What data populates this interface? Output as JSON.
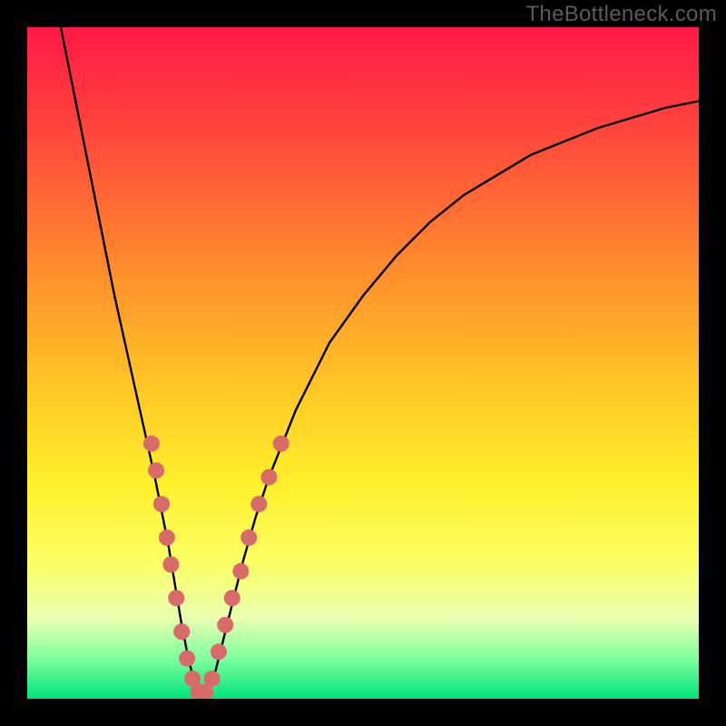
{
  "watermark": "TheBottleneck.com",
  "chart_data": {
    "type": "line",
    "title": "",
    "xlabel": "",
    "ylabel": "",
    "xlim": [
      0,
      100
    ],
    "ylim": [
      0,
      100
    ],
    "grid": false,
    "legend": false,
    "background_gradient": {
      "direction": "vertical",
      "stops": [
        {
          "pos": 0,
          "color": "#ff1a47"
        },
        {
          "pos": 12,
          "color": "#ff3b3f"
        },
        {
          "pos": 26,
          "color": "#ff6a33"
        },
        {
          "pos": 40,
          "color": "#ff9a2b"
        },
        {
          "pos": 54,
          "color": "#ffc826"
        },
        {
          "pos": 68,
          "color": "#fff02c"
        },
        {
          "pos": 80,
          "color": "#fbff66"
        },
        {
          "pos": 88,
          "color": "#e9ffb0"
        },
        {
          "pos": 94,
          "color": "#7fff9e"
        },
        {
          "pos": 100,
          "color": "#00e47a"
        }
      ]
    },
    "series": [
      {
        "name": "bottleneck-curve",
        "color": "#000000",
        "x": [
          5,
          7,
          9,
          11,
          13,
          15,
          17,
          19,
          21,
          22,
          23,
          24,
          25,
          26,
          27,
          28,
          30,
          32,
          34,
          36,
          40,
          45,
          50,
          55,
          60,
          65,
          70,
          75,
          80,
          85,
          90,
          95,
          100
        ],
        "y": [
          100,
          90,
          80,
          70,
          60,
          51,
          42,
          33,
          23,
          17,
          11,
          6,
          2,
          0,
          1,
          4,
          12,
          20,
          27,
          33,
          43,
          53,
          60,
          66,
          71,
          75,
          78,
          81,
          83,
          85,
          86.5,
          88,
          89
        ]
      }
    ],
    "markers": [
      {
        "name": "curve-markers",
        "shape": "circle",
        "color": "#d96a6a",
        "radius_px": 9,
        "points": [
          {
            "x": 18.5,
            "y": 38
          },
          {
            "x": 19.2,
            "y": 34
          },
          {
            "x": 20.0,
            "y": 29
          },
          {
            "x": 20.8,
            "y": 24
          },
          {
            "x": 21.4,
            "y": 20
          },
          {
            "x": 22.2,
            "y": 15
          },
          {
            "x": 23.0,
            "y": 10
          },
          {
            "x": 23.8,
            "y": 6
          },
          {
            "x": 24.6,
            "y": 3
          },
          {
            "x": 25.5,
            "y": 1
          },
          {
            "x": 26.5,
            "y": 1
          },
          {
            "x": 27.5,
            "y": 3
          },
          {
            "x": 28.5,
            "y": 7
          },
          {
            "x": 29.5,
            "y": 11
          },
          {
            "x": 30.5,
            "y": 15
          },
          {
            "x": 31.8,
            "y": 19
          },
          {
            "x": 33.0,
            "y": 24
          },
          {
            "x": 34.5,
            "y": 29
          },
          {
            "x": 36.0,
            "y": 33
          },
          {
            "x": 37.8,
            "y": 38
          }
        ]
      }
    ]
  }
}
